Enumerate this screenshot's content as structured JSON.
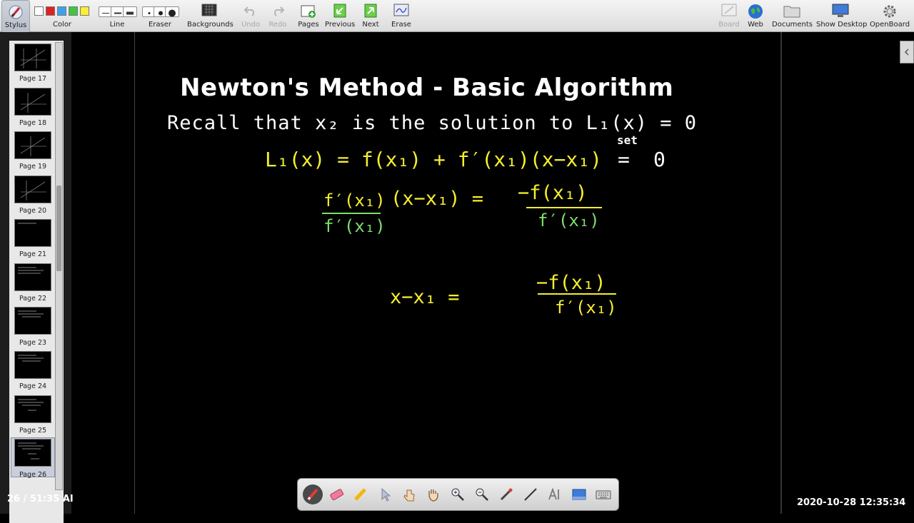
{
  "toolbar": {
    "stylus": "Stylus",
    "color": "Color",
    "line": "Line",
    "eraser": "Eraser",
    "backgrounds": "Backgrounds",
    "undo": "Undo",
    "redo": "Redo",
    "pages": "Pages",
    "previous": "Previous",
    "next": "Next",
    "erase": "Erase",
    "board": "Board",
    "web": "Web",
    "documents": "Documents",
    "show_desktop": "Show Desktop",
    "openboard": "OpenBoard"
  },
  "colors": {
    "swatches": [
      "#ffffff",
      "#e02020",
      "#3da3e8",
      "#43c443",
      "#ffef33"
    ],
    "ink_white": "#ffffff",
    "ink_yellow": "#f6ef2e",
    "ink_green": "#7de06a"
  },
  "thumbnails": [
    "Page 17",
    "Page 18",
    "Page 19",
    "Page 20",
    "Page 21",
    "Page 22",
    "Page 23",
    "Page 24",
    "Page 25",
    "Page 26"
  ],
  "status_left": "26 / 51:35 AI",
  "timestamp": "2020-10-28  12:35:34",
  "board": {
    "title": "Newton's Method - Basic Algorithm",
    "recall_line": "Recall that x₂ is the solution to L₁(x) = 0",
    "line2_lhs": "L₁(x) = f(x₁) + f′(x₁)(x−x₁)",
    "set_label": "set",
    "line2_rhs": "0",
    "line3_num": "f′(x₁)",
    "line3_mid": "(x−x₁) =",
    "line3_den": "f′(x₁)",
    "line3_rhs_num": "−f(x₁)",
    "line3_rhs_den": "f′(x₁)",
    "line4_lhs": "x−x₁ =",
    "line4_rhs_num": "−f(x₁)",
    "line4_rhs_den": "f′(x₁)"
  }
}
